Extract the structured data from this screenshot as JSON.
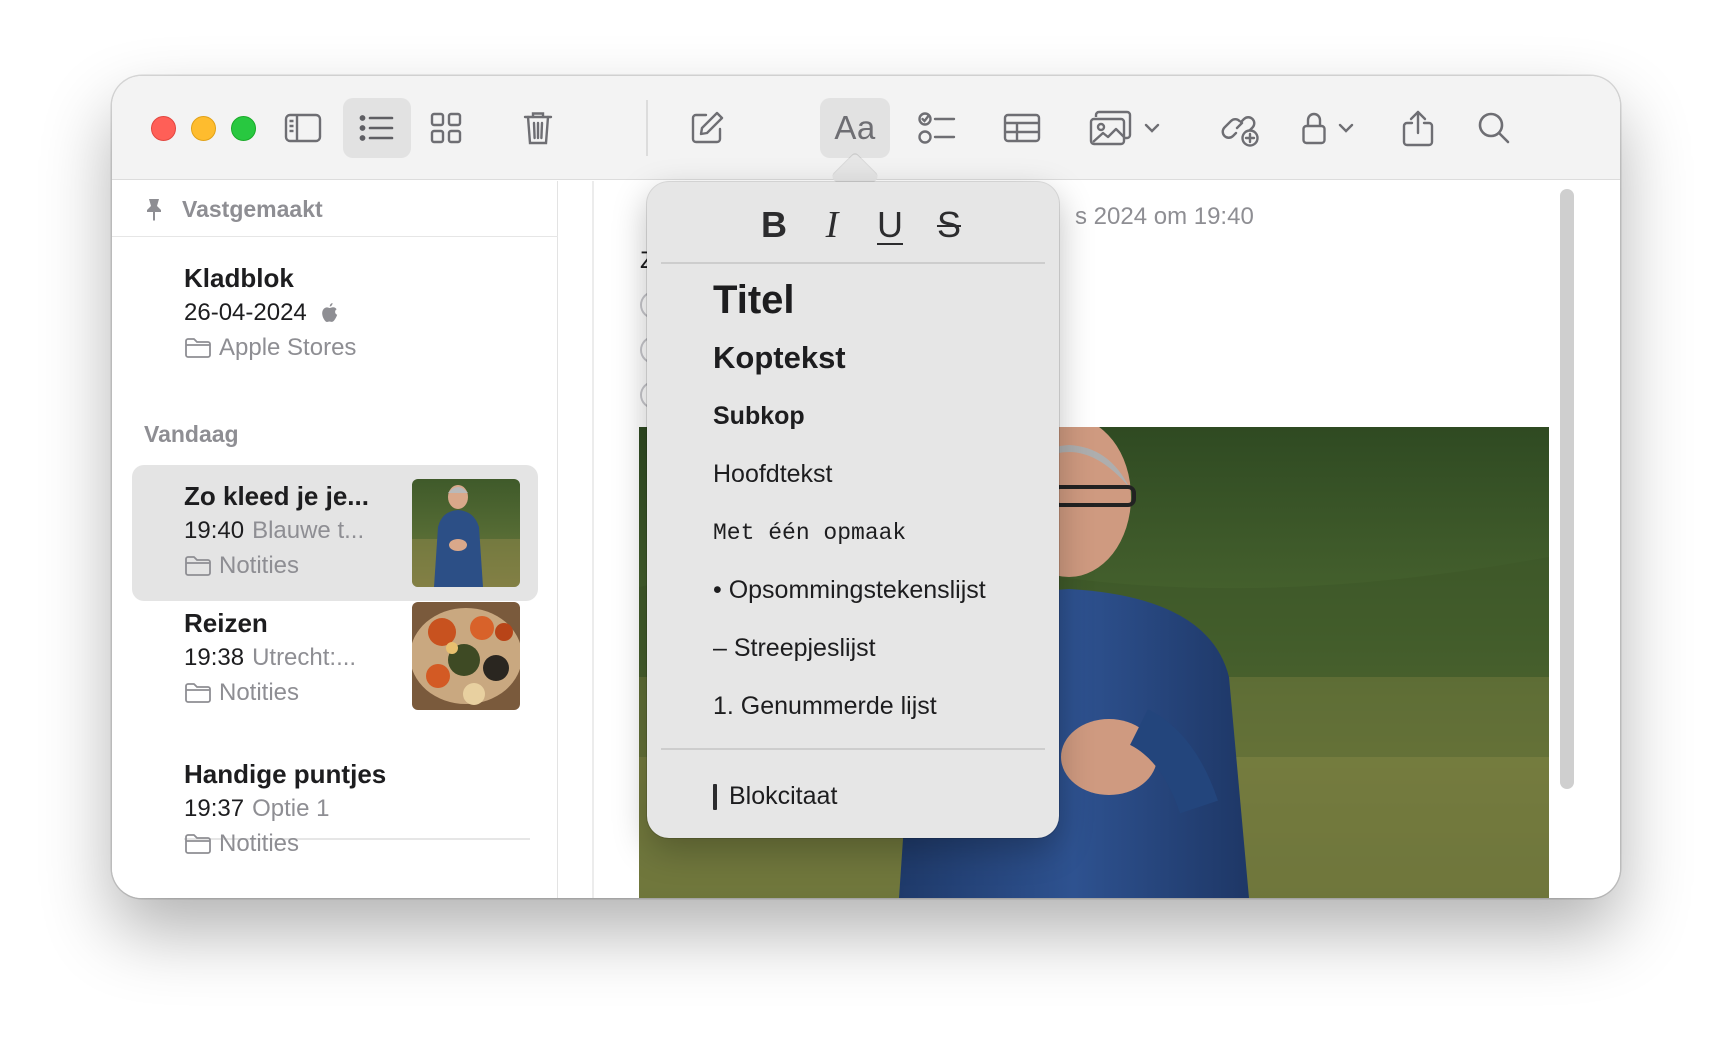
{
  "toolbar": {
    "buttons": [
      "sidebar-toggle",
      "list-view",
      "gallery-view",
      "delete",
      "compose",
      "format",
      "checklist",
      "table",
      "media",
      "collaborate",
      "lock",
      "share",
      "search"
    ],
    "format_label": "Aa"
  },
  "sidebar": {
    "pinned_label": "Vastgemaakt",
    "pinned_note": {
      "title": "Kladblok",
      "date": "26-04-2024",
      "folder": "Apple Stores"
    },
    "today_label": "Vandaag",
    "notes": [
      {
        "title": "Zo kleed je je...",
        "time": "19:40",
        "preview": "Blauwe t...",
        "folder": "Notities",
        "selected": true
      },
      {
        "title": "Reizen",
        "time": "19:38",
        "preview": "Utrecht:...",
        "folder": "Notities",
        "selected": false
      },
      {
        "title": "Handige puntjes",
        "time": "19:37",
        "preview": "Optie 1",
        "folder": "Notities",
        "selected": false
      }
    ]
  },
  "editor": {
    "date_text": "s 2024 om 19:40",
    "first_char": "Z"
  },
  "format_popover": {
    "bold": "B",
    "italic": "I",
    "underline": "U",
    "strikethrough": "S",
    "styles": {
      "title": "Titel",
      "heading": "Koptekst",
      "subheading": "Subkop",
      "body": "Hoofdtekst",
      "monostyled": "Met één opmaak",
      "bulleted": "• Opsommingstekenslijst",
      "dashed": "– Streepjeslijst",
      "numbered": "1. Genummerde lijst",
      "blockquote": "Blokcitaat"
    }
  },
  "colors": {
    "close": "#ff5f57",
    "minimize": "#febc2e",
    "maximize": "#28c840",
    "toolbar_bg": "#f3f3f3",
    "selected_note": "#e4e4e4",
    "popover_bg": "#e6e6e6"
  }
}
